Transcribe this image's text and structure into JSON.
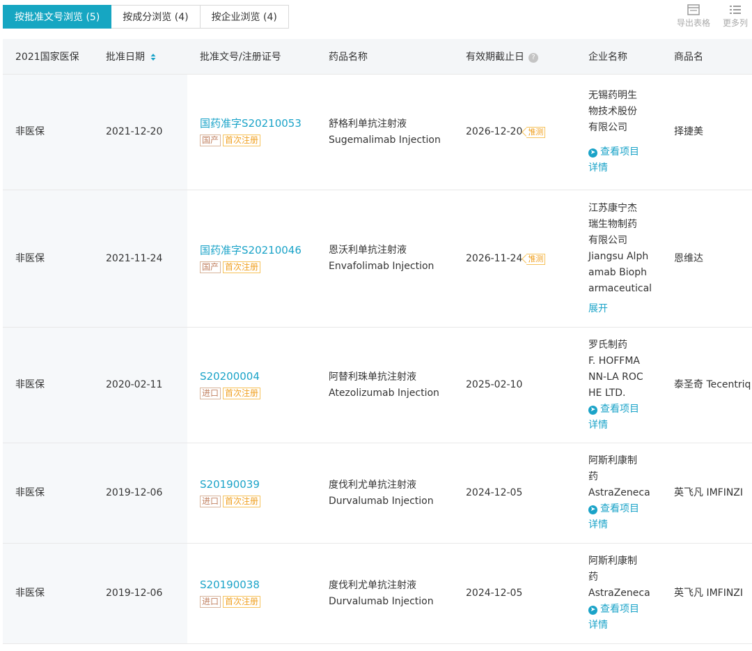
{
  "tabs": [
    {
      "label": "按批准文号浏览 (5)",
      "active": true
    },
    {
      "label": "按成分浏览 (4)",
      "active": false
    },
    {
      "label": "按企业浏览 (4)",
      "active": false
    }
  ],
  "toolbar": {
    "export_label": "导出表格",
    "more_label": "更多列"
  },
  "table": {
    "headers": {
      "insurance": "2021国家医保",
      "approval_date": "批准日期",
      "approval_no": "批准文号/注册证号",
      "drug_name": "药品名称",
      "expiry": "有效期截止日",
      "company": "企业名称",
      "brand": "商品名"
    },
    "rows": [
      {
        "insurance": "非医保",
        "approval_date": "2021-12-20",
        "approval_no": "国药准字S20210053",
        "origin_tag": "国产",
        "first_tag": "首次注册",
        "drug_cn": "舒格利单抗注射液",
        "drug_en": "Sugemalimab Injection",
        "expiry": "2026-12-20",
        "est_tag": "推测",
        "company_lines": [
          "无锡药明生",
          "物技术股份",
          "有限公司"
        ],
        "company_link_lines": [
          "查看项目",
          "详情"
        ],
        "brand": "择捷美"
      },
      {
        "insurance": "非医保",
        "approval_date": "2021-11-24",
        "approval_no": "国药准字S20210046",
        "origin_tag": "国产",
        "first_tag": "首次注册",
        "drug_cn": "恩沃利单抗注射液",
        "drug_en": "Envafolimab Injection",
        "expiry": "2026-11-24",
        "est_tag": "推测",
        "company_lines": [
          "江苏康宁杰",
          "瑞生物制药",
          "有限公司",
          "Jiangsu Alph",
          "amab Bioph",
          "armaceutical"
        ],
        "company_link_lines": [
          "展开"
        ],
        "brand": "恩维达"
      },
      {
        "insurance": "非医保",
        "approval_date": "2020-02-11",
        "approval_no": "S20200004",
        "origin_tag": "进口",
        "first_tag": "首次注册",
        "drug_cn": "阿替利珠单抗注射液",
        "drug_en": "Atezolizumab Injection",
        "expiry": "2025-02-10",
        "est_tag": "",
        "company_lines": [
          "罗氏制药",
          "F. HOFFMA",
          "NN-LA ROC",
          "HE LTD."
        ],
        "company_link_lines": [
          "查看项目",
          "详情"
        ],
        "brand": "泰圣奇 Tecentriq"
      },
      {
        "insurance": "非医保",
        "approval_date": "2019-12-06",
        "approval_no": "S20190039",
        "origin_tag": "进口",
        "first_tag": "首次注册",
        "drug_cn": "度伐利尤单抗注射液",
        "drug_en": "Durvalumab Injection",
        "expiry": "2024-12-05",
        "est_tag": "",
        "company_lines": [
          "阿斯利康制",
          "药",
          "AstraZeneca"
        ],
        "company_link_lines": [
          "查看项目",
          "详情"
        ],
        "brand": "英飞凡 IMFINZI"
      },
      {
        "insurance": "非医保",
        "approval_date": "2019-12-06",
        "approval_no": "S20190038",
        "origin_tag": "进口",
        "first_tag": "首次注册",
        "drug_cn": "度伐利尤单抗注射液",
        "drug_en": "Durvalumab Injection",
        "expiry": "2024-12-05",
        "est_tag": "",
        "company_lines": [
          "阿斯利康制",
          "药",
          "AstraZeneca"
        ],
        "company_link_lines": [
          "查看项目",
          "详情"
        ],
        "brand": "英飞凡 IMFINZI"
      }
    ]
  },
  "colors": {
    "accent": "#16a6c2",
    "link": "#1aa3c8",
    "tag_orange": "#f0a020"
  }
}
